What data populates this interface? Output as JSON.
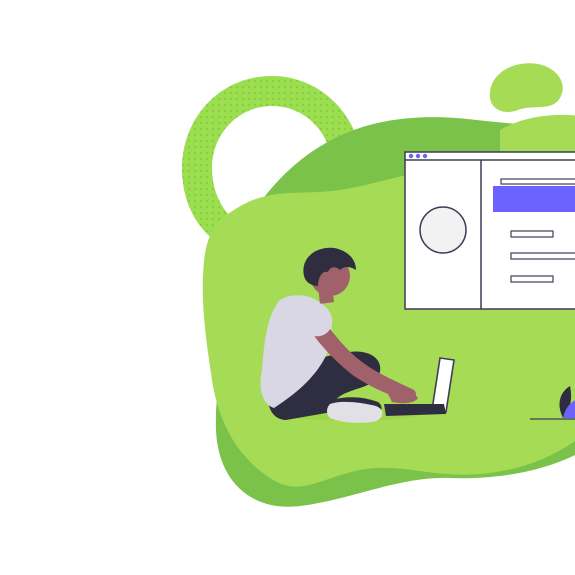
{
  "colors": {
    "background": "#ffffff",
    "blob_light": "#a6dc55",
    "blob_mid": "#8fd13f",
    "blob_dark": "#78bd45",
    "ring": "#8fd13f",
    "window_bg": "#ffffff",
    "window_border": "#3f3d56",
    "accent": "#6c63ff",
    "shirt": "#d9d7e3",
    "skin": "#a0616a",
    "hair": "#2f2e41",
    "pants": "#2f2e41",
    "shoe": "#e6e6e6"
  },
  "icons": {
    "person": "person-sitting-with-laptop-illustration",
    "window": "browser-window-mockup",
    "ring": "dotted-ring-decoration",
    "blob": "green-blob-background"
  }
}
